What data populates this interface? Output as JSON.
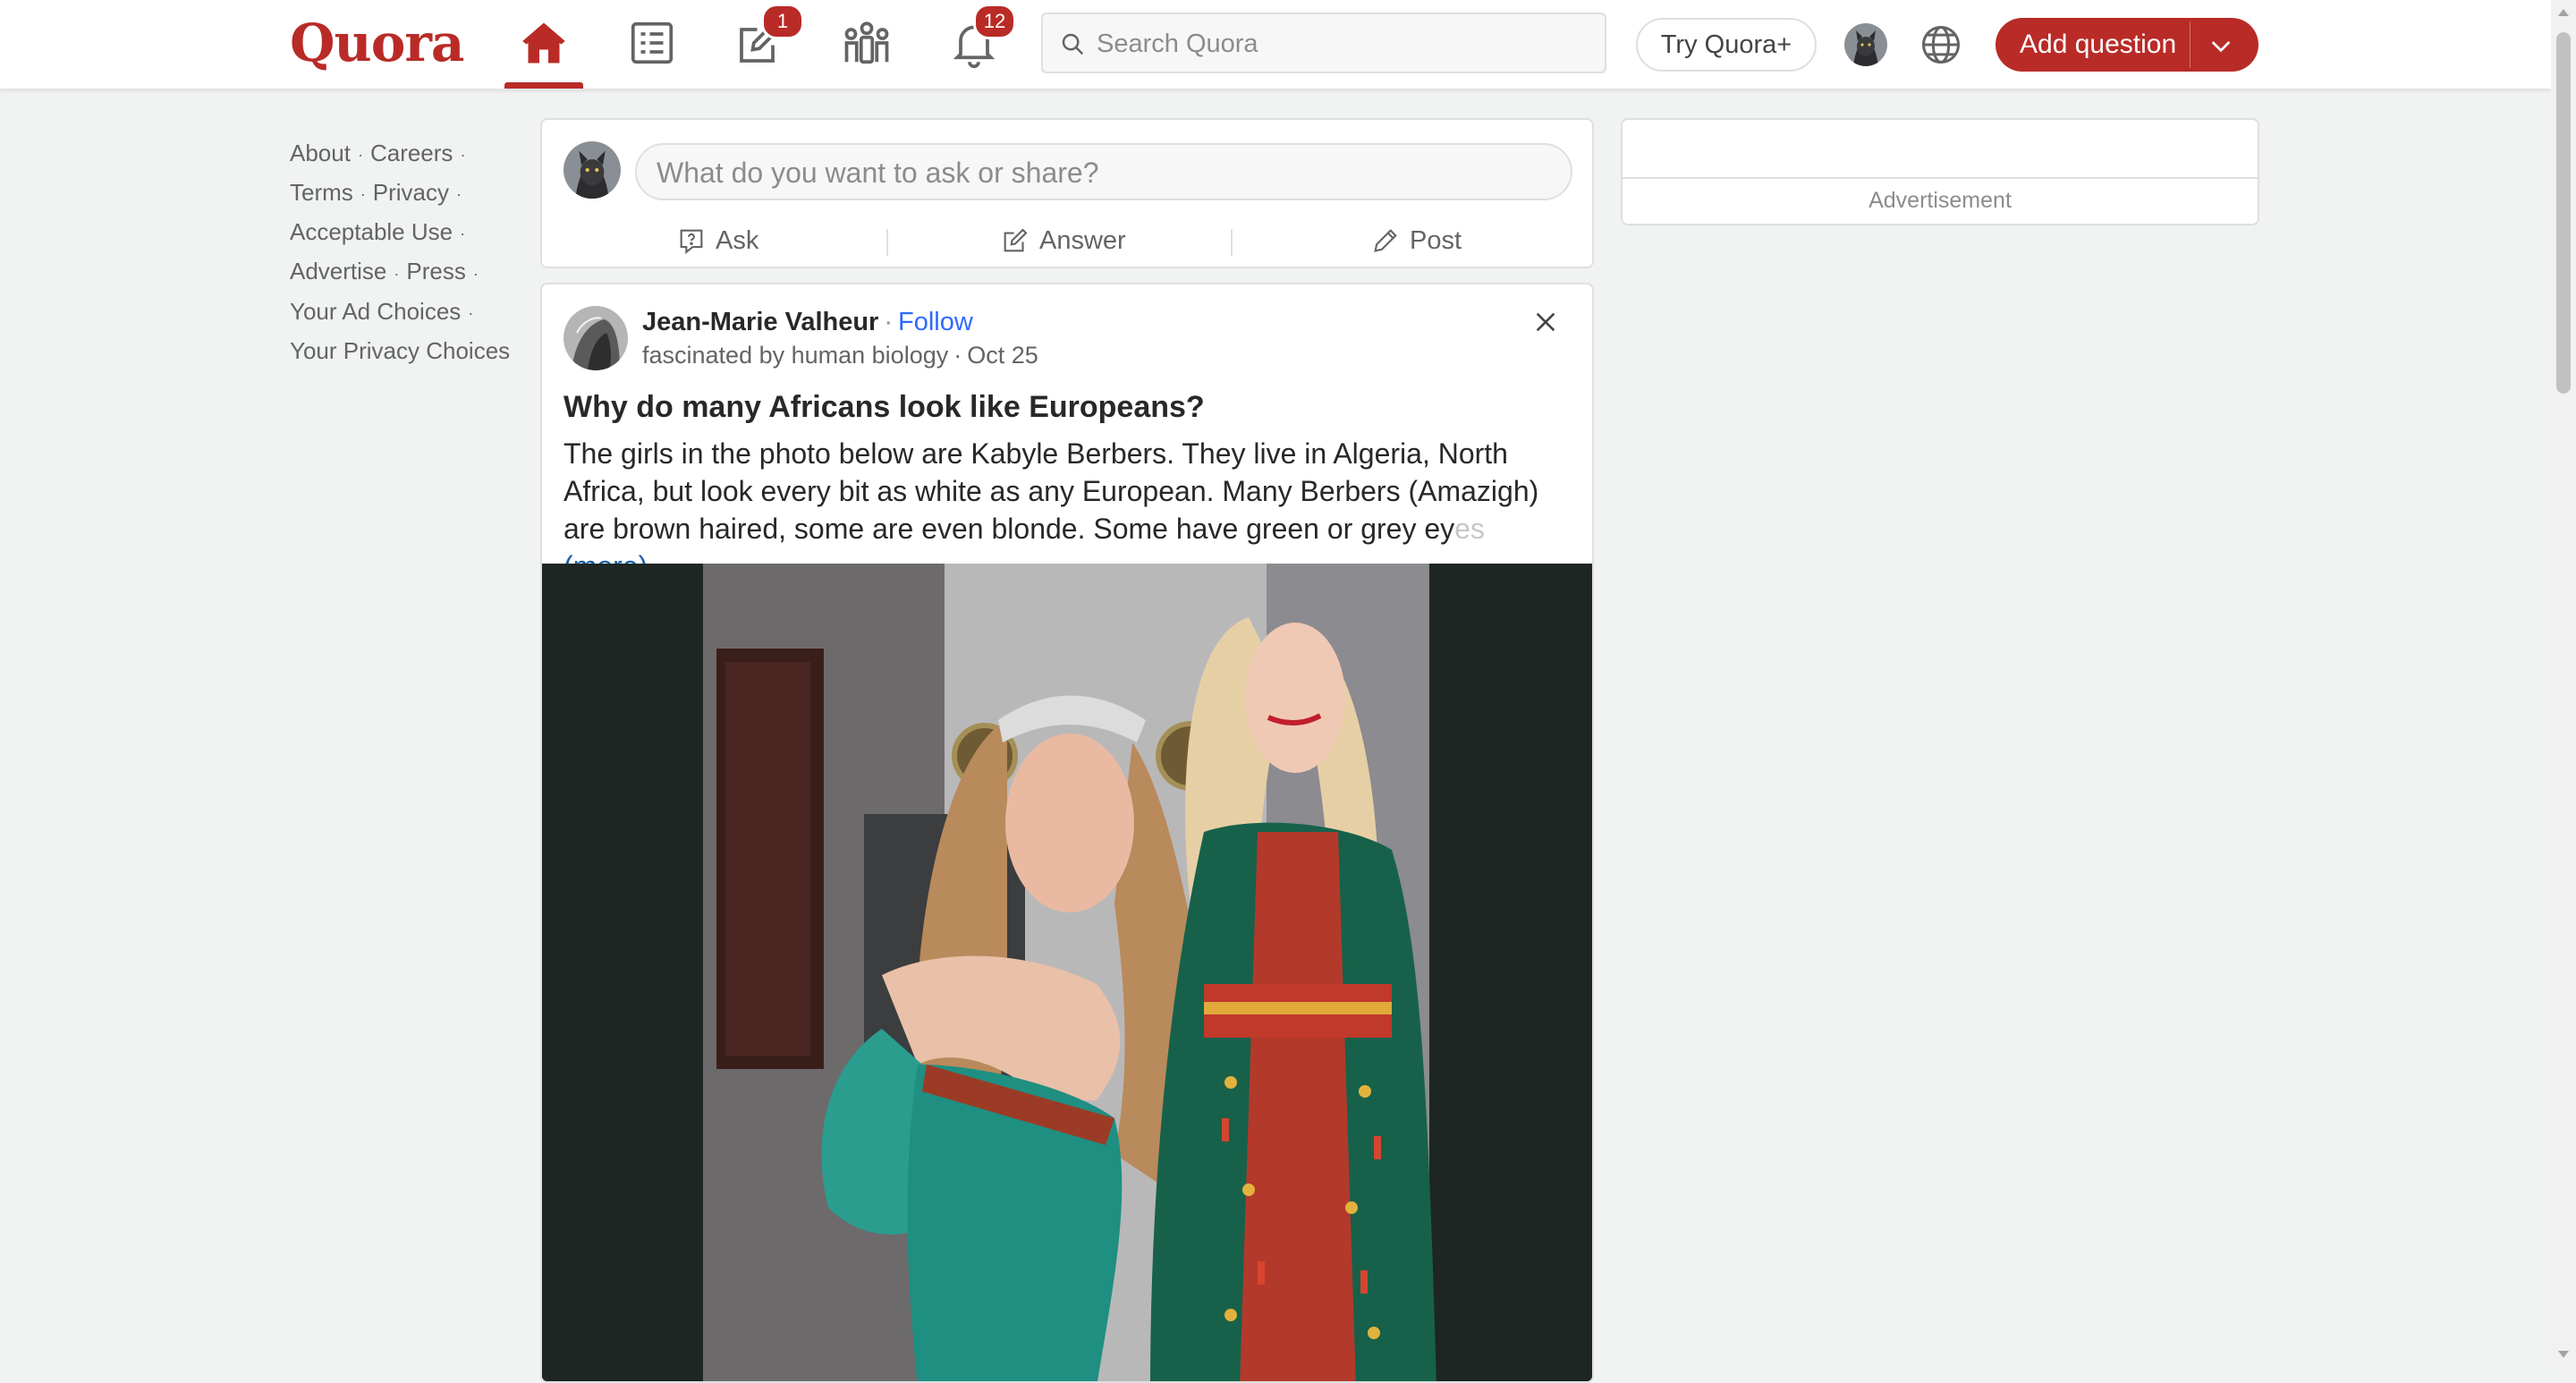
{
  "header": {
    "logo": "Quora",
    "nav": [
      {
        "name": "home-icon",
        "active": true
      },
      {
        "name": "following-icon"
      },
      {
        "name": "answer-icon",
        "badge": "1"
      },
      {
        "name": "spaces-icon"
      },
      {
        "name": "notifications-icon",
        "badge": "12"
      }
    ],
    "search_placeholder": "Search Quora",
    "try_plus": "Try Quora+",
    "add_question": "Add question",
    "accent": "#b92b27"
  },
  "sidebar": {
    "links": [
      [
        "About",
        "Careers"
      ],
      [
        "Terms",
        "Privacy"
      ],
      [
        "Acceptable Use"
      ],
      [
        "Advertise",
        "Press"
      ],
      [
        "Your Ad Choices"
      ],
      [
        "Your Privacy Choices"
      ]
    ]
  },
  "composer": {
    "placeholder": "What do you want to ask or share?",
    "ask": "Ask",
    "answer": "Answer",
    "post": "Post"
  },
  "post": {
    "author": "Jean-Marie Valheur",
    "follow": "Follow",
    "credential": "fascinated by human biology",
    "date": "Oct 25",
    "question": "Why do many Africans look like Europeans?",
    "body_line1": "The girls in the photo below are Kabyle Berbers. They live in Algeria, North",
    "body_line2": "Africa, but look every bit as white as any European. Many Berbers (Amazigh)",
    "body_line3": "are brown haired, some are even blonde. Some have green or grey ey",
    "body_line3_fade": "es",
    "more": "(more)"
  },
  "ad": {
    "label": "Advertisement"
  }
}
